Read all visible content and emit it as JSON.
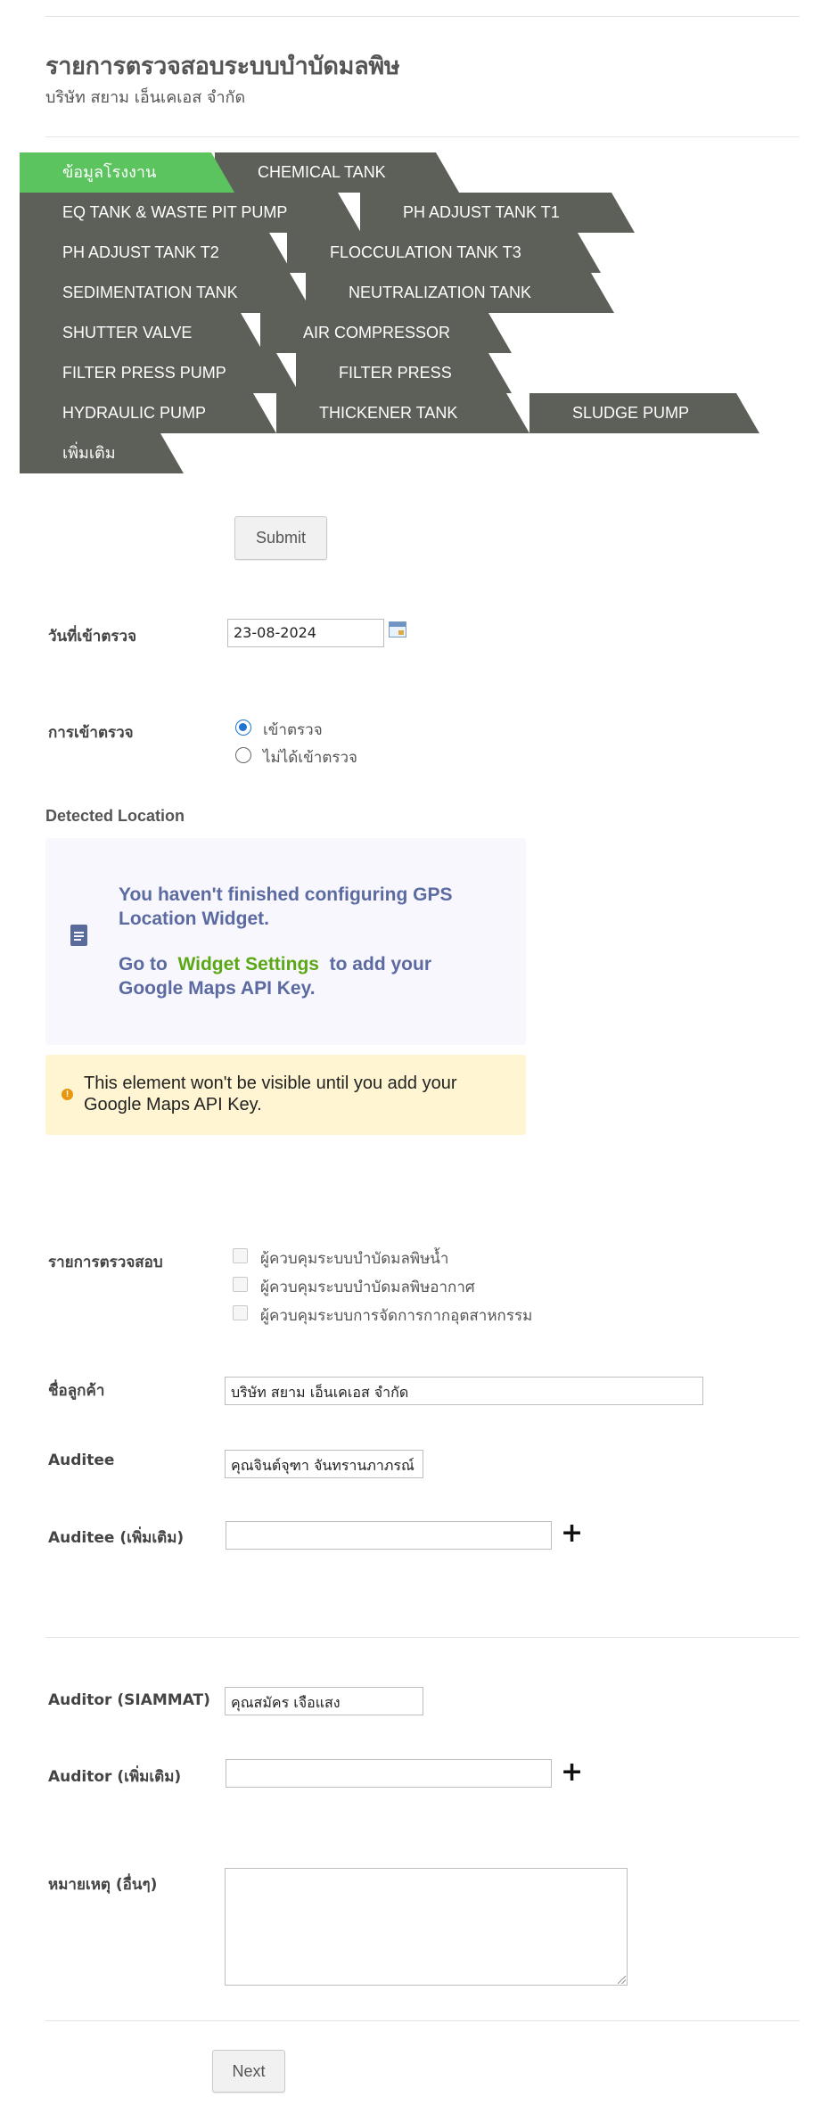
{
  "header": {
    "title": "รายการตรวจสอบระบบบำบัดมลพิษ",
    "subtitle": "บริษัท สยาม เอ็นเคเอส จำกัด"
  },
  "tabs": [
    {
      "label": "ข้อมูลโรงงาน",
      "active": true
    },
    {
      "label": "CHEMICAL TANK"
    },
    {
      "label": "EQ TANK & WASTE PIT PUMP"
    },
    {
      "label": "PH ADJUST TANK T1"
    },
    {
      "label": "PH ADJUST TANK T2"
    },
    {
      "label": "FLOCCULATION TANK T3"
    },
    {
      "label": "SEDIMENTATION TANK"
    },
    {
      "label": "NEUTRALIZATION TANK"
    },
    {
      "label": "SHUTTER VALVE"
    },
    {
      "label": "AIR COMPRESSOR"
    },
    {
      "label": "FILTER PRESS PUMP"
    },
    {
      "label": "FILTER PRESS"
    },
    {
      "label": "HYDRAULIC PUMP"
    },
    {
      "label": "THICKENER TANK"
    },
    {
      "label": "SLUDGE PUMP"
    },
    {
      "label": "เพิ่มเติม"
    }
  ],
  "submit_label": "Submit",
  "visit_date": {
    "label": "วันที่เข้าตรวจ",
    "value": "23-08-2024"
  },
  "visit": {
    "label": "การเข้าตรวจ",
    "options": [
      "เข้าตรวจ",
      "ไม่ได้เข้าตรวจ"
    ],
    "selected": "เข้าตรวจ"
  },
  "location": {
    "title": "Detected Location",
    "line1": "You haven't finished configuring GPS",
    "line2": "Location Widget.",
    "goto": "Go to",
    "link": "Widget Settings",
    "after_link": "to add your",
    "line4": "Google Maps API Key.",
    "warning_line1": "This element won't be visible until you add your",
    "warning_line2": "Google Maps API Key."
  },
  "checklist": {
    "label": "รายการตรวจสอบ",
    "items": [
      "ผู้ควบคุมระบบบำบัดมลพิษน้ำ",
      "ผู้ควบคุมระบบบำบัดมลพิษอากาศ",
      "ผู้ควบคุมระบบการจัดการกากอุตสาหกรรม"
    ]
  },
  "customer": {
    "label": "ชื่อลูกค้า",
    "value": "บริษัท สยาม เอ็นเคเอส จำกัด"
  },
  "auditee": {
    "label": "Auditee",
    "value": "คุณจินต์จุฑา จันทรานภาภรณ์"
  },
  "auditee_more": {
    "label": "Auditee (เพิ่มเติม)",
    "value": ""
  },
  "auditor": {
    "label": "Auditor (SIAMMAT)",
    "value": "คุณสมัคร เจือแสง"
  },
  "auditor_more": {
    "label": "Auditor (เพิ่มเติม)",
    "value": ""
  },
  "notes": {
    "label": "หมายเหตุ (อื่นๆ)",
    "value": ""
  },
  "next_label": "Next",
  "colors": {
    "tab_active": "#5bc45f",
    "tab_inactive": "#5d5f59",
    "gps_text": "#5b6aa0",
    "gps_link": "#5ba816",
    "warning_bg": "#fff5d2",
    "radio_selected": "#1f74d1"
  }
}
